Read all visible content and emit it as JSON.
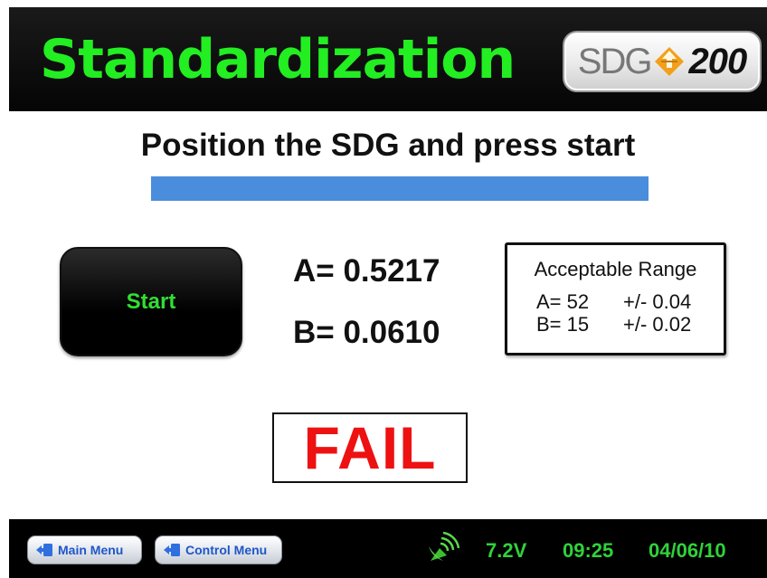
{
  "header": {
    "title": "Standardization",
    "logo": {
      "prefix": "SDG",
      "number": "200",
      "mark_icon": "arrow-diamond-icon"
    }
  },
  "main": {
    "instruction": "Position the SDG and press start",
    "progress_fraction": 1.0,
    "start_label": "Start",
    "reading_a": "A= 0.5217",
    "reading_b": "B= 0.0610",
    "range": {
      "title": "Acceptable Range",
      "a_value": "A= 52",
      "a_tolerance": "+/- 0.04",
      "b_value": "B= 15",
      "b_tolerance": "+/- 0.02"
    },
    "result": "FAIL"
  },
  "footer": {
    "main_menu_label": "Main Menu",
    "control_menu_label": "Control Menu",
    "signal_icon": "satellite-dish-icon",
    "voltage": "7.2V",
    "time": "09:25",
    "date": "04/06/10"
  },
  "colors": {
    "title_green": "#22ee22",
    "status_green": "#2fd23a",
    "fail_red": "#ee1111",
    "progress_blue": "#4a8ddc",
    "nav_blue": "#1f56c8"
  }
}
